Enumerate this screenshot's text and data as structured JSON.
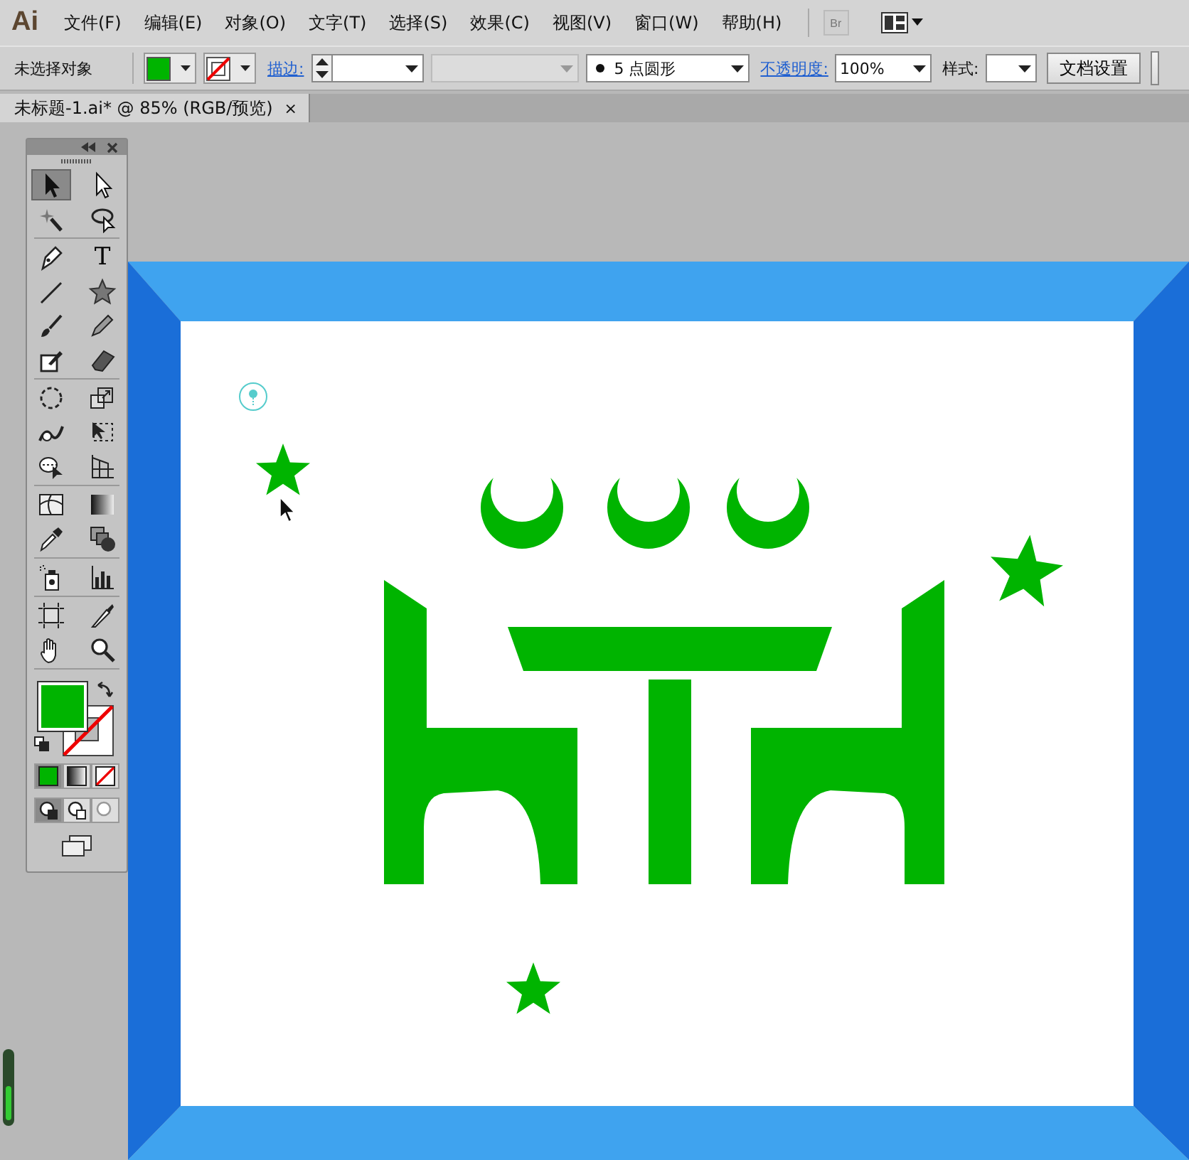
{
  "app": {
    "logo": "Ai"
  },
  "menu": [
    "文件(F)",
    "编辑(E)",
    "对象(O)",
    "文字(T)",
    "选择(S)",
    "效果(C)",
    "视图(V)",
    "窗口(W)",
    "帮助(H)"
  ],
  "bridge": {
    "label": "Br",
    "disabled": true
  },
  "control_bar": {
    "selection": "未选择对象",
    "stroke_label": "描边:",
    "brush": "5 点圆形",
    "opacity_label": "不透明度:",
    "opacity": "100%",
    "style_label": "样式:",
    "doc_settings": "文档设置"
  },
  "document_tab": {
    "title": "未标题-1.ai* @ 85% (RGB/预览)",
    "close": "×"
  },
  "tools": [
    [
      {
        "kind": "selection",
        "selected": true
      },
      {
        "kind": "direct",
        "selected": false
      },
      {
        "kind": "wand",
        "selected": false
      },
      {
        "kind": "lasso",
        "selected": false
      }
    ],
    [
      {
        "kind": "pen",
        "selected": false
      },
      {
        "kind": "type",
        "glyph": "T",
        "selected": false
      },
      {
        "kind": "line",
        "selected": false
      },
      {
        "kind": "star",
        "selected": false
      },
      {
        "kind": "brush",
        "selected": false
      },
      {
        "kind": "pencil",
        "selected": false
      },
      {
        "kind": "blob",
        "selected": false
      },
      {
        "kind": "eraser",
        "selected": false
      }
    ],
    [
      {
        "kind": "rotate",
        "selected": false
      },
      {
        "kind": "scale",
        "selected": false
      },
      {
        "kind": "warp",
        "selected": false
      },
      {
        "kind": "transform",
        "selected": false
      },
      {
        "kind": "builder",
        "selected": false
      },
      {
        "kind": "perspective",
        "selected": false
      }
    ],
    [
      {
        "kind": "mesh",
        "selected": false
      },
      {
        "kind": "gradient",
        "selected": false
      },
      {
        "kind": "eyedropper",
        "selected": false
      },
      {
        "kind": "blend",
        "selected": false
      }
    ],
    [
      {
        "kind": "sprayer",
        "selected": false
      },
      {
        "kind": "graph",
        "selected": false
      }
    ],
    [
      {
        "kind": "artboard",
        "selected": false
      },
      {
        "kind": "slice",
        "selected": false
      },
      {
        "kind": "hand",
        "selected": false
      },
      {
        "kind": "zoom",
        "selected": false
      }
    ]
  ],
  "color_modes": [
    {
      "kind": "color",
      "selected": true
    },
    {
      "kind": "gradient",
      "selected": false
    },
    {
      "kind": "none",
      "selected": false
    }
  ],
  "draw_modes": [
    {
      "kind": "normal",
      "selected": true
    },
    {
      "kind": "behind",
      "selected": false
    },
    {
      "kind": "inside",
      "selected": false
    }
  ]
}
